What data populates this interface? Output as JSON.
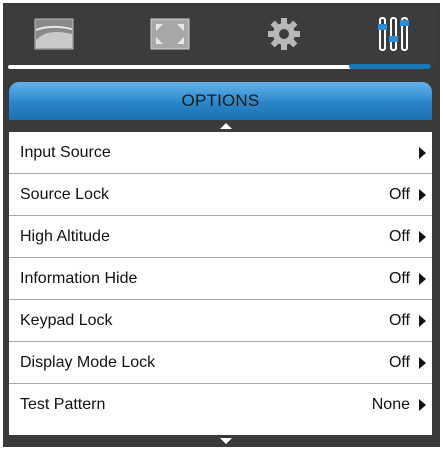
{
  "tabs": [
    {
      "icon": "image-icon"
    },
    {
      "icon": "fullscreen-icon"
    },
    {
      "icon": "gear-icon"
    },
    {
      "icon": "sliders-icon"
    }
  ],
  "menu": {
    "title": "OPTIONS",
    "items": [
      {
        "label": "Input Source",
        "value": ""
      },
      {
        "label": "Source Lock",
        "value": "Off"
      },
      {
        "label": "High Altitude",
        "value": "Off"
      },
      {
        "label": "Information Hide",
        "value": "Off"
      },
      {
        "label": "Keypad Lock",
        "value": "Off"
      },
      {
        "label": "Display Mode Lock",
        "value": "Off"
      },
      {
        "label": "Test Pattern",
        "value": "None"
      }
    ]
  },
  "colors": {
    "accent": "#1b78b8",
    "header_top": "#62b3ea",
    "frame": "#3a3a3a",
    "separator": "#a8a8a8"
  }
}
